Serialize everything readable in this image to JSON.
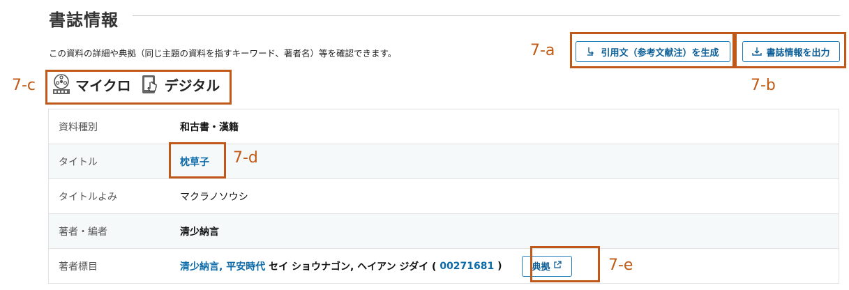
{
  "section": {
    "title": "書誌情報",
    "description": "この資料の詳細や典拠（同じ主題の資料を指すキーワード、著者名）等を確認できます。"
  },
  "actions": {
    "cite_label": "引用文（参考文献注）を生成",
    "export_label": "書誌情報を出力"
  },
  "badges": [
    {
      "label": "マイクロ",
      "icon": "microfilm-icon"
    },
    {
      "label": "デジタル",
      "icon": "digital-touch-icon"
    }
  ],
  "callouts": {
    "a": "7-a",
    "b": "7-b",
    "c": "7-c",
    "d": "7-d",
    "e": "7-e"
  },
  "table": {
    "rows": [
      {
        "label": "資料種別",
        "value": "和古書・漢籍"
      },
      {
        "label": "タイトル",
        "value": "枕草子"
      },
      {
        "label": "タイトルよみ",
        "value": "マクラノソウシ"
      },
      {
        "label": "著者・編者",
        "value": "清少納言"
      },
      {
        "label": "著者標目"
      }
    ],
    "author_heading": {
      "link1": "清少納言,",
      "link2": "平安時代",
      "reading": "セイ ショウナゴン, ヘイアン ジダイ (",
      "id": "00271681",
      "close": ")",
      "authority_button": "典拠"
    }
  },
  "colors": {
    "accent": "#0b6aa8",
    "callout": "#c0581a"
  }
}
